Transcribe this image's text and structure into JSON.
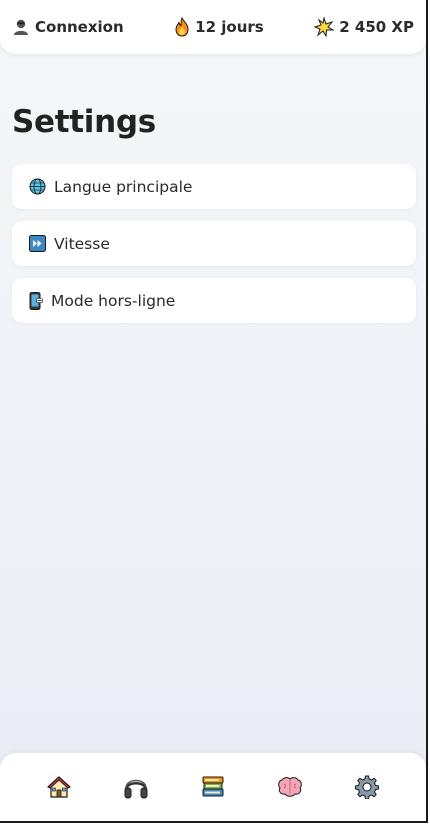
{
  "header": {
    "login": {
      "icon": "user-silhouette-icon",
      "label": "Connexion"
    },
    "streak": {
      "icon": "fire-icon",
      "label": "12 jours"
    },
    "xp": {
      "icon": "sparkle-burst-icon",
      "label": "2 450 XP"
    }
  },
  "page": {
    "title": "Settings"
  },
  "settings": {
    "items": [
      {
        "icon": "globe-icon",
        "label": "Langue principale"
      },
      {
        "icon": "fast-forward-icon",
        "label": "Vitesse"
      },
      {
        "icon": "mobile-off-icon",
        "label": "Mode hors-ligne"
      }
    ]
  },
  "nav": {
    "items": [
      {
        "icon": "home-icon"
      },
      {
        "icon": "headphones-icon"
      },
      {
        "icon": "books-icon"
      },
      {
        "icon": "brain-icon"
      },
      {
        "icon": "gear-icon"
      }
    ]
  },
  "colors": {
    "background_top": "#f5f7fa",
    "background_bottom": "#e9edf3",
    "card": "#ffffff",
    "text": "#222222"
  }
}
